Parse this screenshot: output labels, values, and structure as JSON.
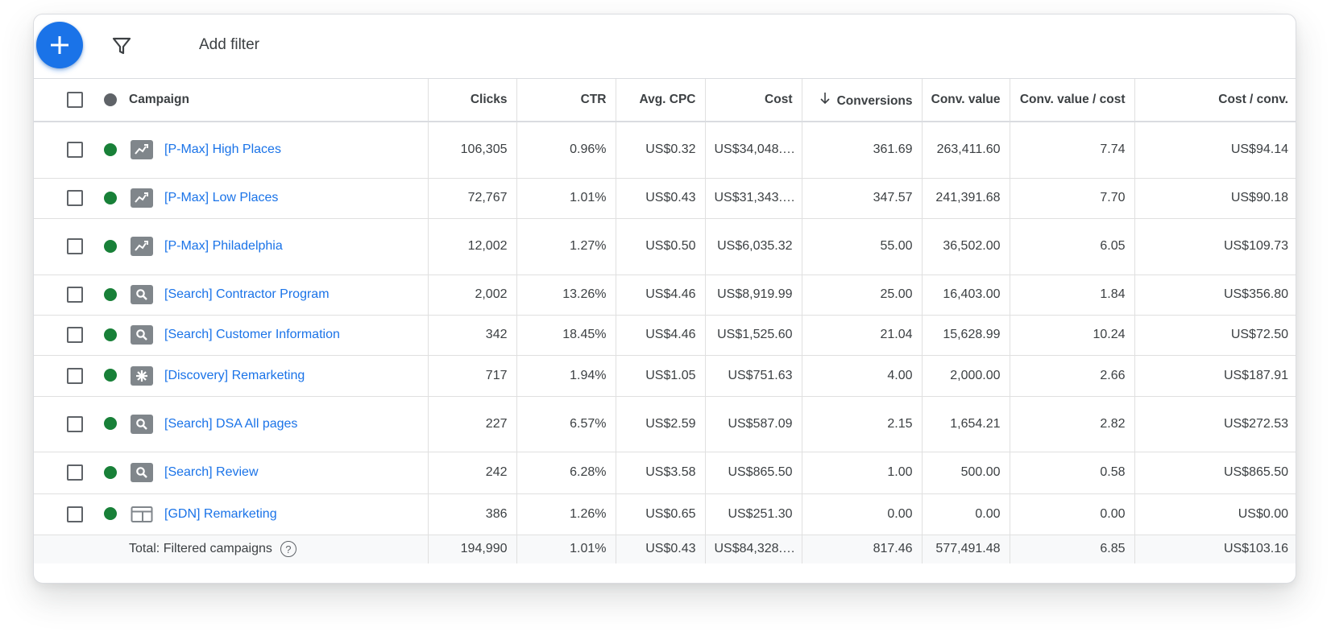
{
  "toolbar": {
    "add_button_icon": "plus-icon",
    "filter_icon": "funnel-icon",
    "add_filter_label": "Add filter"
  },
  "colors": {
    "accent": "#1a73e8",
    "status_enabled": "#188038",
    "status_header": "#5f6368",
    "type_icon": "#80868b"
  },
  "table": {
    "headers": {
      "campaign": "Campaign",
      "clicks": "Clicks",
      "ctr": "CTR",
      "avg_cpc": "Avg. CPC",
      "cost": "Cost",
      "conversions": "Conversions",
      "conv_value": "Conv. value",
      "conv_value_cost": "Conv. value / cost",
      "cost_conv": "Cost / conv."
    },
    "sort": {
      "column": "conversions",
      "direction": "descending",
      "icon": "arrow-down-icon"
    },
    "rows": [
      {
        "type_icon": "performance-max-icon",
        "name": "[P-Max] High Places",
        "clicks": "106,305",
        "ctr": "0.96%",
        "avg_cpc": "US$0.32",
        "cost": "US$34,048.…",
        "conversions": "361.69",
        "conv_value": "263,411.60",
        "conv_value_cost": "7.74",
        "cost_conv": "US$94.14"
      },
      {
        "type_icon": "performance-max-icon",
        "name": "[P-Max] Low Places",
        "clicks": "72,767",
        "ctr": "1.01%",
        "avg_cpc": "US$0.43",
        "cost": "US$31,343.…",
        "conversions": "347.57",
        "conv_value": "241,391.68",
        "conv_value_cost": "7.70",
        "cost_conv": "US$90.18"
      },
      {
        "type_icon": "performance-max-icon",
        "name": "[P-Max] Philadelphia",
        "clicks": "12,002",
        "ctr": "1.27%",
        "avg_cpc": "US$0.50",
        "cost": "US$6,035.32",
        "conversions": "55.00",
        "conv_value": "36,502.00",
        "conv_value_cost": "6.05",
        "cost_conv": "US$109.73"
      },
      {
        "type_icon": "search-icon",
        "name": "[Search] Contractor Program",
        "clicks": "2,002",
        "ctr": "13.26%",
        "avg_cpc": "US$4.46",
        "cost": "US$8,919.99",
        "conversions": "25.00",
        "conv_value": "16,403.00",
        "conv_value_cost": "1.84",
        "cost_conv": "US$356.80"
      },
      {
        "type_icon": "search-icon",
        "name": "[Search] Customer Information",
        "clicks": "342",
        "ctr": "18.45%",
        "avg_cpc": "US$4.46",
        "cost": "US$1,525.60",
        "conversions": "21.04",
        "conv_value": "15,628.99",
        "conv_value_cost": "10.24",
        "cost_conv": "US$72.50"
      },
      {
        "type_icon": "discovery-icon",
        "name": "[Discovery] Remarketing",
        "clicks": "717",
        "ctr": "1.94%",
        "avg_cpc": "US$1.05",
        "cost": "US$751.63",
        "conversions": "4.00",
        "conv_value": "2,000.00",
        "conv_value_cost": "2.66",
        "cost_conv": "US$187.91"
      },
      {
        "type_icon": "search-icon",
        "name": "[Search] DSA All pages",
        "clicks": "227",
        "ctr": "6.57%",
        "avg_cpc": "US$2.59",
        "cost": "US$587.09",
        "conversions": "2.15",
        "conv_value": "1,654.21",
        "conv_value_cost": "2.82",
        "cost_conv": "US$272.53"
      },
      {
        "type_icon": "search-icon",
        "name": "[Search] Review",
        "clicks": "242",
        "ctr": "6.28%",
        "avg_cpc": "US$3.58",
        "cost": "US$865.50",
        "conversions": "1.00",
        "conv_value": "500.00",
        "conv_value_cost": "0.58",
        "cost_conv": "US$865.50"
      },
      {
        "type_icon": "display-icon",
        "name": "[GDN] Remarketing",
        "clicks": "386",
        "ctr": "1.26%",
        "avg_cpc": "US$0.65",
        "cost": "US$251.30",
        "conversions": "0.00",
        "conv_value": "0.00",
        "conv_value_cost": "0.00",
        "cost_conv": "US$0.00"
      }
    ],
    "total": {
      "label": "Total: Filtered campaigns",
      "help_icon": "help-circle-icon",
      "clicks": "194,990",
      "ctr": "1.01%",
      "avg_cpc": "US$0.43",
      "cost": "US$84,328.…",
      "conversions": "817.46",
      "conv_value": "577,491.48",
      "conv_value_cost": "6.85",
      "cost_conv": "US$103.16"
    }
  }
}
